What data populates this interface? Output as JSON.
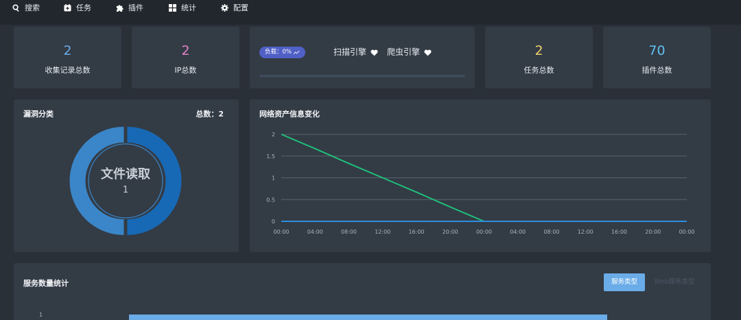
{
  "nav": {
    "search": "搜索",
    "tasks": "任务",
    "plugins": "插件",
    "stats": "统计",
    "config": "配置"
  },
  "stats": {
    "records": {
      "value": "2",
      "label": "收集记录总数",
      "color": "#6aace8"
    },
    "ip": {
      "value": "2",
      "label": "IP总数",
      "color": "#e383c8"
    },
    "tasks": {
      "value": "2",
      "label": "任务总数",
      "color": "#f0d26a"
    },
    "plugins": {
      "value": "70",
      "label": "插件总数",
      "color": "#5fc0f0"
    }
  },
  "engines": {
    "load_label": "负载：0%",
    "scan_engine": "扫描引擎",
    "crawler_engine": "爬虫引擎"
  },
  "vuln": {
    "title": "漏洞分类",
    "total": "总数：2",
    "center_label": "文件读取",
    "center_value": "1"
  },
  "network": {
    "title": "网络资产信息变化"
  },
  "chart_data": {
    "type": "line",
    "x": [
      "00:00",
      "04:00",
      "08:00",
      "12:00",
      "16:00",
      "20:00",
      "00:00",
      "04:00",
      "08:00",
      "12:00",
      "16:00",
      "20:00",
      "00:00"
    ],
    "y_ticks": [
      "0",
      "0.5",
      "1",
      "1.5",
      "2"
    ],
    "ylim": [
      0,
      2
    ],
    "series": [
      {
        "color": "#1fbf7a",
        "values": [
          2,
          1.67,
          1.33,
          1.0,
          0.67,
          0.33,
          0,
          0,
          0,
          0,
          0,
          0,
          0
        ]
      },
      {
        "color": "#2d8fe0",
        "values": [
          0,
          0,
          0,
          0,
          0,
          0,
          0,
          0,
          0,
          0,
          0,
          0,
          0
        ]
      }
    ],
    "grid": true
  },
  "services": {
    "title": "服务数量统计",
    "tab_active": "服务类型",
    "tab_inactive": "Web服务类型",
    "axis_tick": "1",
    "bar_color": "#6aace8"
  }
}
